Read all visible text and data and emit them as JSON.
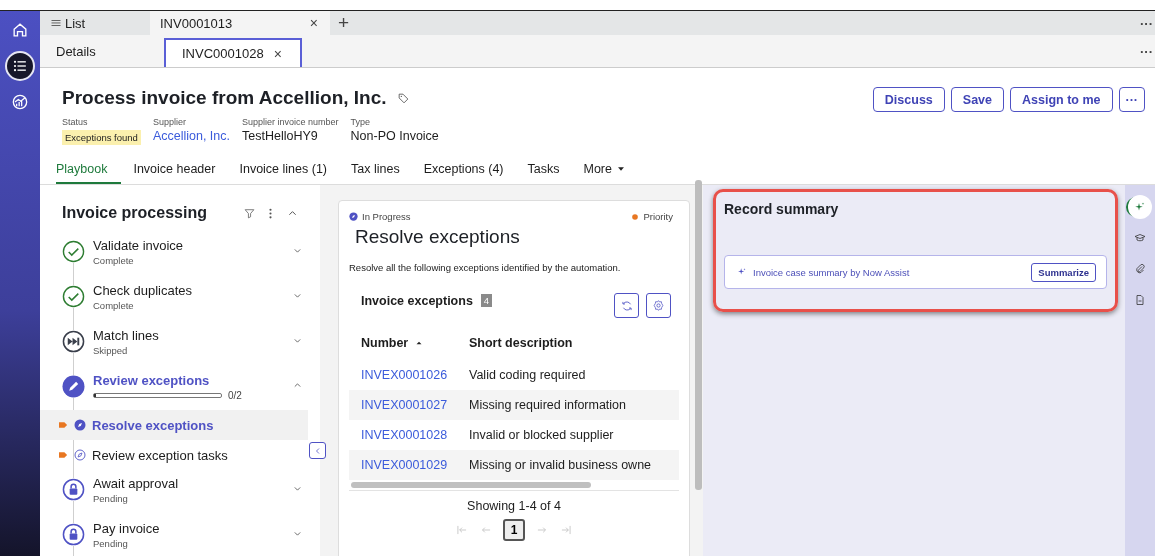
{
  "nav_rail": [
    {
      "kind": "home",
      "selected": false
    },
    {
      "kind": "list",
      "selected": true
    },
    {
      "kind": "analytics",
      "selected": false
    }
  ],
  "workspace_tabs": {
    "items": [
      {
        "label": "List",
        "kind": "list",
        "selected": false,
        "closable": false
      },
      {
        "label": "INV0001013",
        "kind": "record",
        "selected": true,
        "closable": true
      }
    ],
    "close_symbol": "×",
    "add_symbol": "+",
    "overflow": "···"
  },
  "record_tabs": {
    "items": [
      {
        "label": "Details",
        "selected": false,
        "closable": false
      },
      {
        "label": "INVC0001028",
        "selected": true,
        "closable": true
      }
    ],
    "close_symbol": "×",
    "overflow": "···"
  },
  "record": {
    "title": "Process invoice from Accellion, Inc.",
    "fields": [
      {
        "label": "Status",
        "value": "Exceptions found",
        "kind": "badge"
      },
      {
        "label": "Supplier",
        "value": "Accellion, Inc.",
        "kind": "link"
      },
      {
        "label": "Supplier invoice number",
        "value": "TestHelloHY9",
        "kind": "text"
      },
      {
        "label": "Type",
        "value": "Non-PO Invoice",
        "kind": "text"
      }
    ],
    "actions": [
      "Discuss",
      "Save",
      "Assign to me"
    ],
    "overflow": "···"
  },
  "tabs": [
    {
      "label": "Playbook",
      "kind": "tab",
      "selected": true
    },
    {
      "label": "Invoice header",
      "kind": "tab",
      "selected": false
    },
    {
      "label": "Invoice lines (1)",
      "kind": "tab",
      "selected": false
    },
    {
      "label": "Tax lines",
      "kind": "tab",
      "selected": false
    },
    {
      "label": "Exceptions (4)",
      "kind": "tab",
      "selected": false
    },
    {
      "label": "Tasks",
      "kind": "tab",
      "selected": false
    },
    {
      "label": "More",
      "kind": "menu",
      "selected": false
    }
  ],
  "playbook": {
    "title": "Invoice processing",
    "stages": [
      {
        "title": "Validate invoice",
        "status": "Complete",
        "kind": "complete",
        "expanded": false
      },
      {
        "title": "Check duplicates",
        "status": "Complete",
        "kind": "complete",
        "expanded": false
      },
      {
        "title": "Match lines",
        "status": "Skipped",
        "kind": "skipped",
        "expanded": false
      },
      {
        "title": "Review exceptions",
        "kind": "active",
        "expanded": true,
        "progress": "0/2",
        "level": 0,
        "children": [
          {
            "label": "Resolve exceptions",
            "selected": true
          },
          {
            "label": "Review exception tasks",
            "selected": false
          }
        ]
      },
      {
        "title": "Await approval",
        "status": "Pending",
        "kind": "pending",
        "expanded": false
      },
      {
        "title": "Pay invoice",
        "status": "Pending",
        "kind": "pending",
        "expanded": false
      }
    ]
  },
  "activity": {
    "status": "In Progress",
    "priority": "Priority",
    "title": "Resolve exceptions",
    "description": "Resolve all the following exceptions identified by the automation.",
    "list": {
      "title": "Invoice exceptions",
      "count": "4",
      "columns": [
        {
          "label": "Number",
          "sorted": true
        },
        {
          "label": "Short description",
          "sorted": false
        }
      ],
      "rows": [
        {
          "number": "INVEX0001026",
          "description": "Valid coding required"
        },
        {
          "number": "INVEX0001027",
          "description": "Missing required information"
        },
        {
          "number": "INVEX0001028",
          "description": "Invalid or blocked supplier"
        },
        {
          "number": "INVEX0001029",
          "description": "Missing or invalid business owne"
        }
      ],
      "summary": "Showing 1-4 of 4",
      "pages": [
        {
          "label": "1",
          "selected": true
        }
      ]
    }
  },
  "record_summary": {
    "title": "Record summary",
    "assist_label": "Invoice case summary by Now Assist",
    "action": "Summarize",
    "highlighted": true
  },
  "side_rail": [
    {
      "kind": "sparkle",
      "selected": true
    },
    {
      "kind": "learning",
      "selected": false
    },
    {
      "kind": "attachment",
      "selected": false
    },
    {
      "kind": "document",
      "selected": false
    }
  ]
}
